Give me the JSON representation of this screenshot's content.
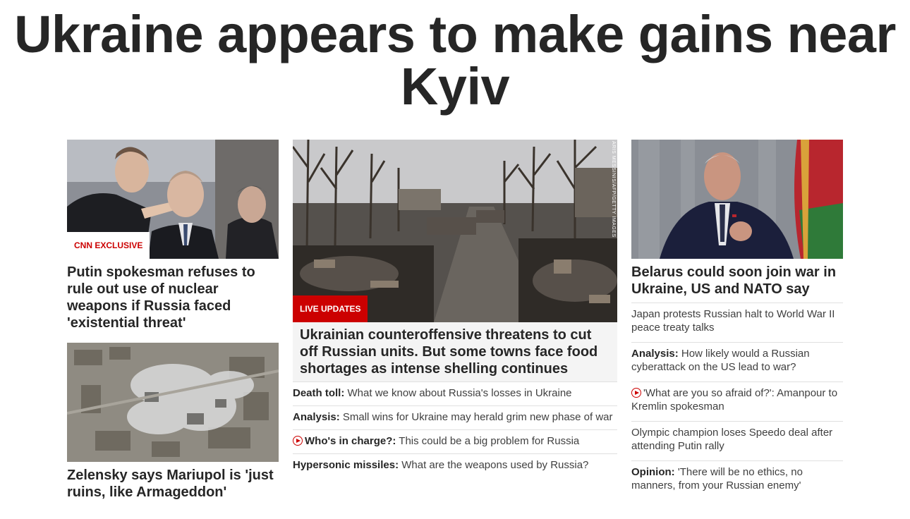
{
  "headline": "Ukraine appears to make gains near Kyiv",
  "left": {
    "story1": {
      "image_icon": "photo-kremlin-officials",
      "tag": "CNN EXCLUSIVE",
      "title": "Putin spokesman refuses to rule out use of nuclear weapons if Russia faced 'existential threat'"
    },
    "story2": {
      "image_icon": "photo-satellite-mariupol",
      "title": "Zelensky says Mariupol is 'just ruins, like Armageddon'"
    }
  },
  "mid": {
    "image_icon": "photo-destroyed-tanks-street",
    "photo_credit": "ARIS MESSINIS/AFP/GETTY IMAGES",
    "tag": "LIVE UPDATES",
    "title": "Ukrainian counteroffensive threatens to cut off Russian units. But some towns face food shortages as intense shelling continues",
    "items": [
      {
        "bold": "Death toll:",
        "text": " What we know about Russia's losses in Ukraine",
        "video": false
      },
      {
        "bold": "Analysis:",
        "text": " Small wins for Ukraine may herald grim new phase of war",
        "video": false
      },
      {
        "bold": "Who's in charge?:",
        "text": " This could be a big problem for Russia",
        "video": true
      },
      {
        "bold": "Hypersonic missiles:",
        "text": " What are the weapons used by Russia?",
        "video": false
      }
    ]
  },
  "right": {
    "image_icon": "photo-belarus-leader-interview",
    "title": "Belarus could soon join war in Ukraine, US and NATO say",
    "items": [
      {
        "bold": "",
        "text": "Japan protests Russian halt to World War II peace treaty talks",
        "video": false
      },
      {
        "bold": "Analysis:",
        "text": " How likely would a Russian cyberattack on the US lead to war?",
        "video": false
      },
      {
        "bold": "",
        "text": "'What are you so afraid of?': Amanpour to Kremlin spokesman",
        "video": true
      },
      {
        "bold": "",
        "text": "Olympic champion loses Speedo deal after attending Putin rally",
        "video": false
      },
      {
        "bold": "Opinion:",
        "text": " 'There will be no ethics, no manners, from your Russian enemy'",
        "video": false
      }
    ]
  },
  "colors": {
    "accent": "#cc0000",
    "text": "#262626",
    "muted": "#404040"
  }
}
